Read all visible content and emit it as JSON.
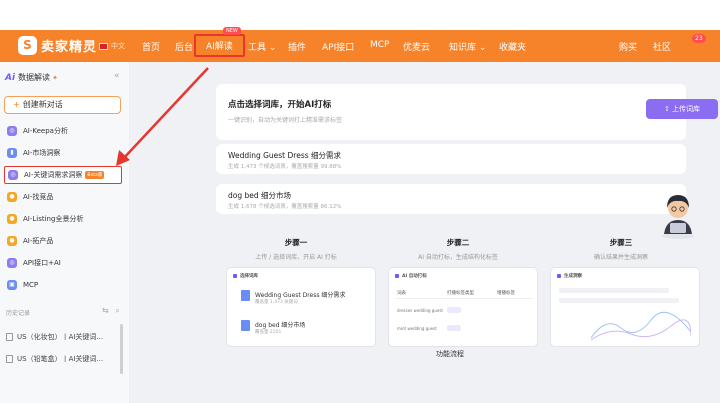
{
  "topnav": {
    "logo_mark": "S",
    "logo_text": "卖家精灵",
    "lang": "中文",
    "items": [
      "首页",
      "后台",
      "AI解读",
      "工具",
      "插件",
      "API接口",
      "MCP",
      "优麦云",
      "知识库",
      "收藏夹"
    ],
    "new_badge": "NEW",
    "right_items": [
      "购买",
      "社区"
    ],
    "notif_count": "23"
  },
  "sidebar": {
    "logo_ai": "Ai",
    "title": "数据解读",
    "new_chat": "创建新对话",
    "items": [
      {
        "label": "AI-Keepa分析"
      },
      {
        "label": "AI-市场洞察"
      },
      {
        "label": "AI-关键词需求洞察",
        "tag": "Beta版"
      },
      {
        "label": "AI-找竞品"
      },
      {
        "label": "AI-Listing全景分析"
      },
      {
        "label": "AI-拓产品"
      },
      {
        "label": "API接口+AI"
      },
      {
        "label": "MCP"
      }
    ],
    "history_label": "历史记录",
    "history": [
      "US（化妆包）丨AI关键词...",
      "US（铅笔盒）丨AI关键词..."
    ]
  },
  "main": {
    "top_card": {
      "title": "点击选择词库，开始AI打标",
      "subtitle": "一键识别，自动为关键词打上精准需求标签",
      "upload_button": "上传词库"
    },
    "datasets": [
      {
        "title": "Wedding Guest Dress 细分需求",
        "meta": "生成 1,473 个候选词表，覆盖搜索量 99.88%"
      },
      {
        "title": "dog bed 细分市场",
        "meta": "生成 1,678 个候选词表，覆盖搜索量 86.12%"
      }
    ],
    "steps": [
      {
        "name": "步骤一",
        "desc": "上传 / 选择词库、开启 AI 打标"
      },
      {
        "name": "步骤二",
        "desc": "AI 自动打标，生成结构化标签"
      },
      {
        "name": "步骤三",
        "desc": "确认结果并生成洞察"
      }
    ],
    "shots": {
      "s1_title": "选择词库",
      "s1_rows": [
        {
          "name": "Wedding Guest Dress 细分需求",
          "meta": "覆盖量 1,473 关键词"
        },
        {
          "name": "dog bed 细分市场",
          "meta": "覆盖量 2201"
        }
      ],
      "s2_title": "AI 自动打标",
      "s2_cols": [
        "词表",
        "打播标签类型",
        "增播标签"
      ],
      "s2_rows": [
        "dresses wedding guest",
        "mint wedding guest"
      ],
      "s3_title": "生成洞察"
    },
    "caption": "功能流程"
  },
  "colors": {
    "brand": "#f6832a",
    "accent": "#8a6df0",
    "highlight_red": "#e8352e"
  }
}
